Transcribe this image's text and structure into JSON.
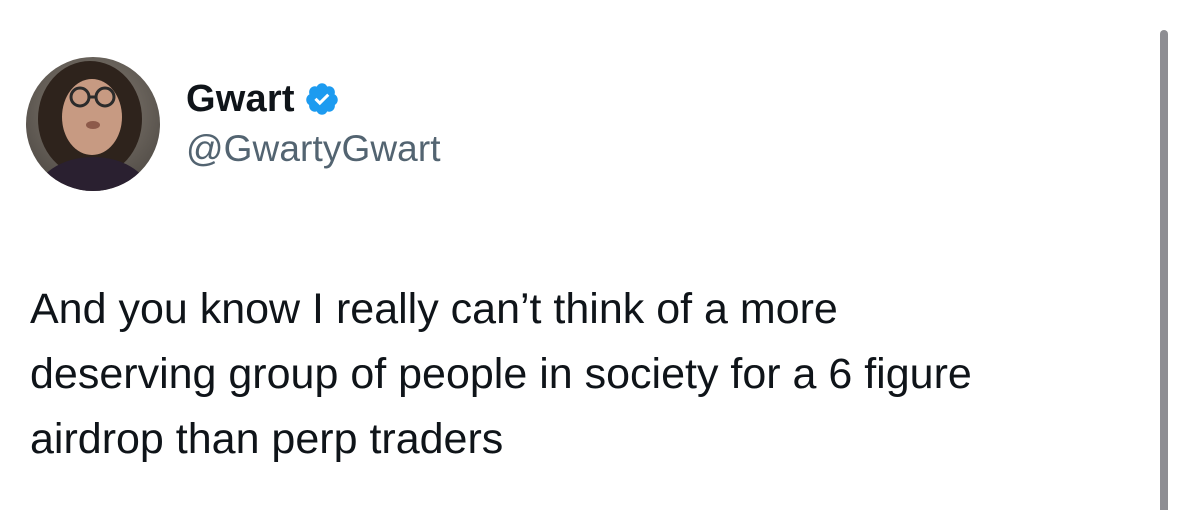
{
  "author": {
    "display_name": "Gwart",
    "handle": "@GwartyGwart",
    "verified": true,
    "verified_badge_color": "#1d9bf0"
  },
  "tweet": {
    "text_lines": [
      "And you know I really can’t think of a more",
      "deserving group of people in society for a 6 figure",
      "airdrop than perp traders"
    ]
  },
  "icons": {
    "verified": "verified-badge-icon",
    "avatar": "profile-avatar"
  }
}
